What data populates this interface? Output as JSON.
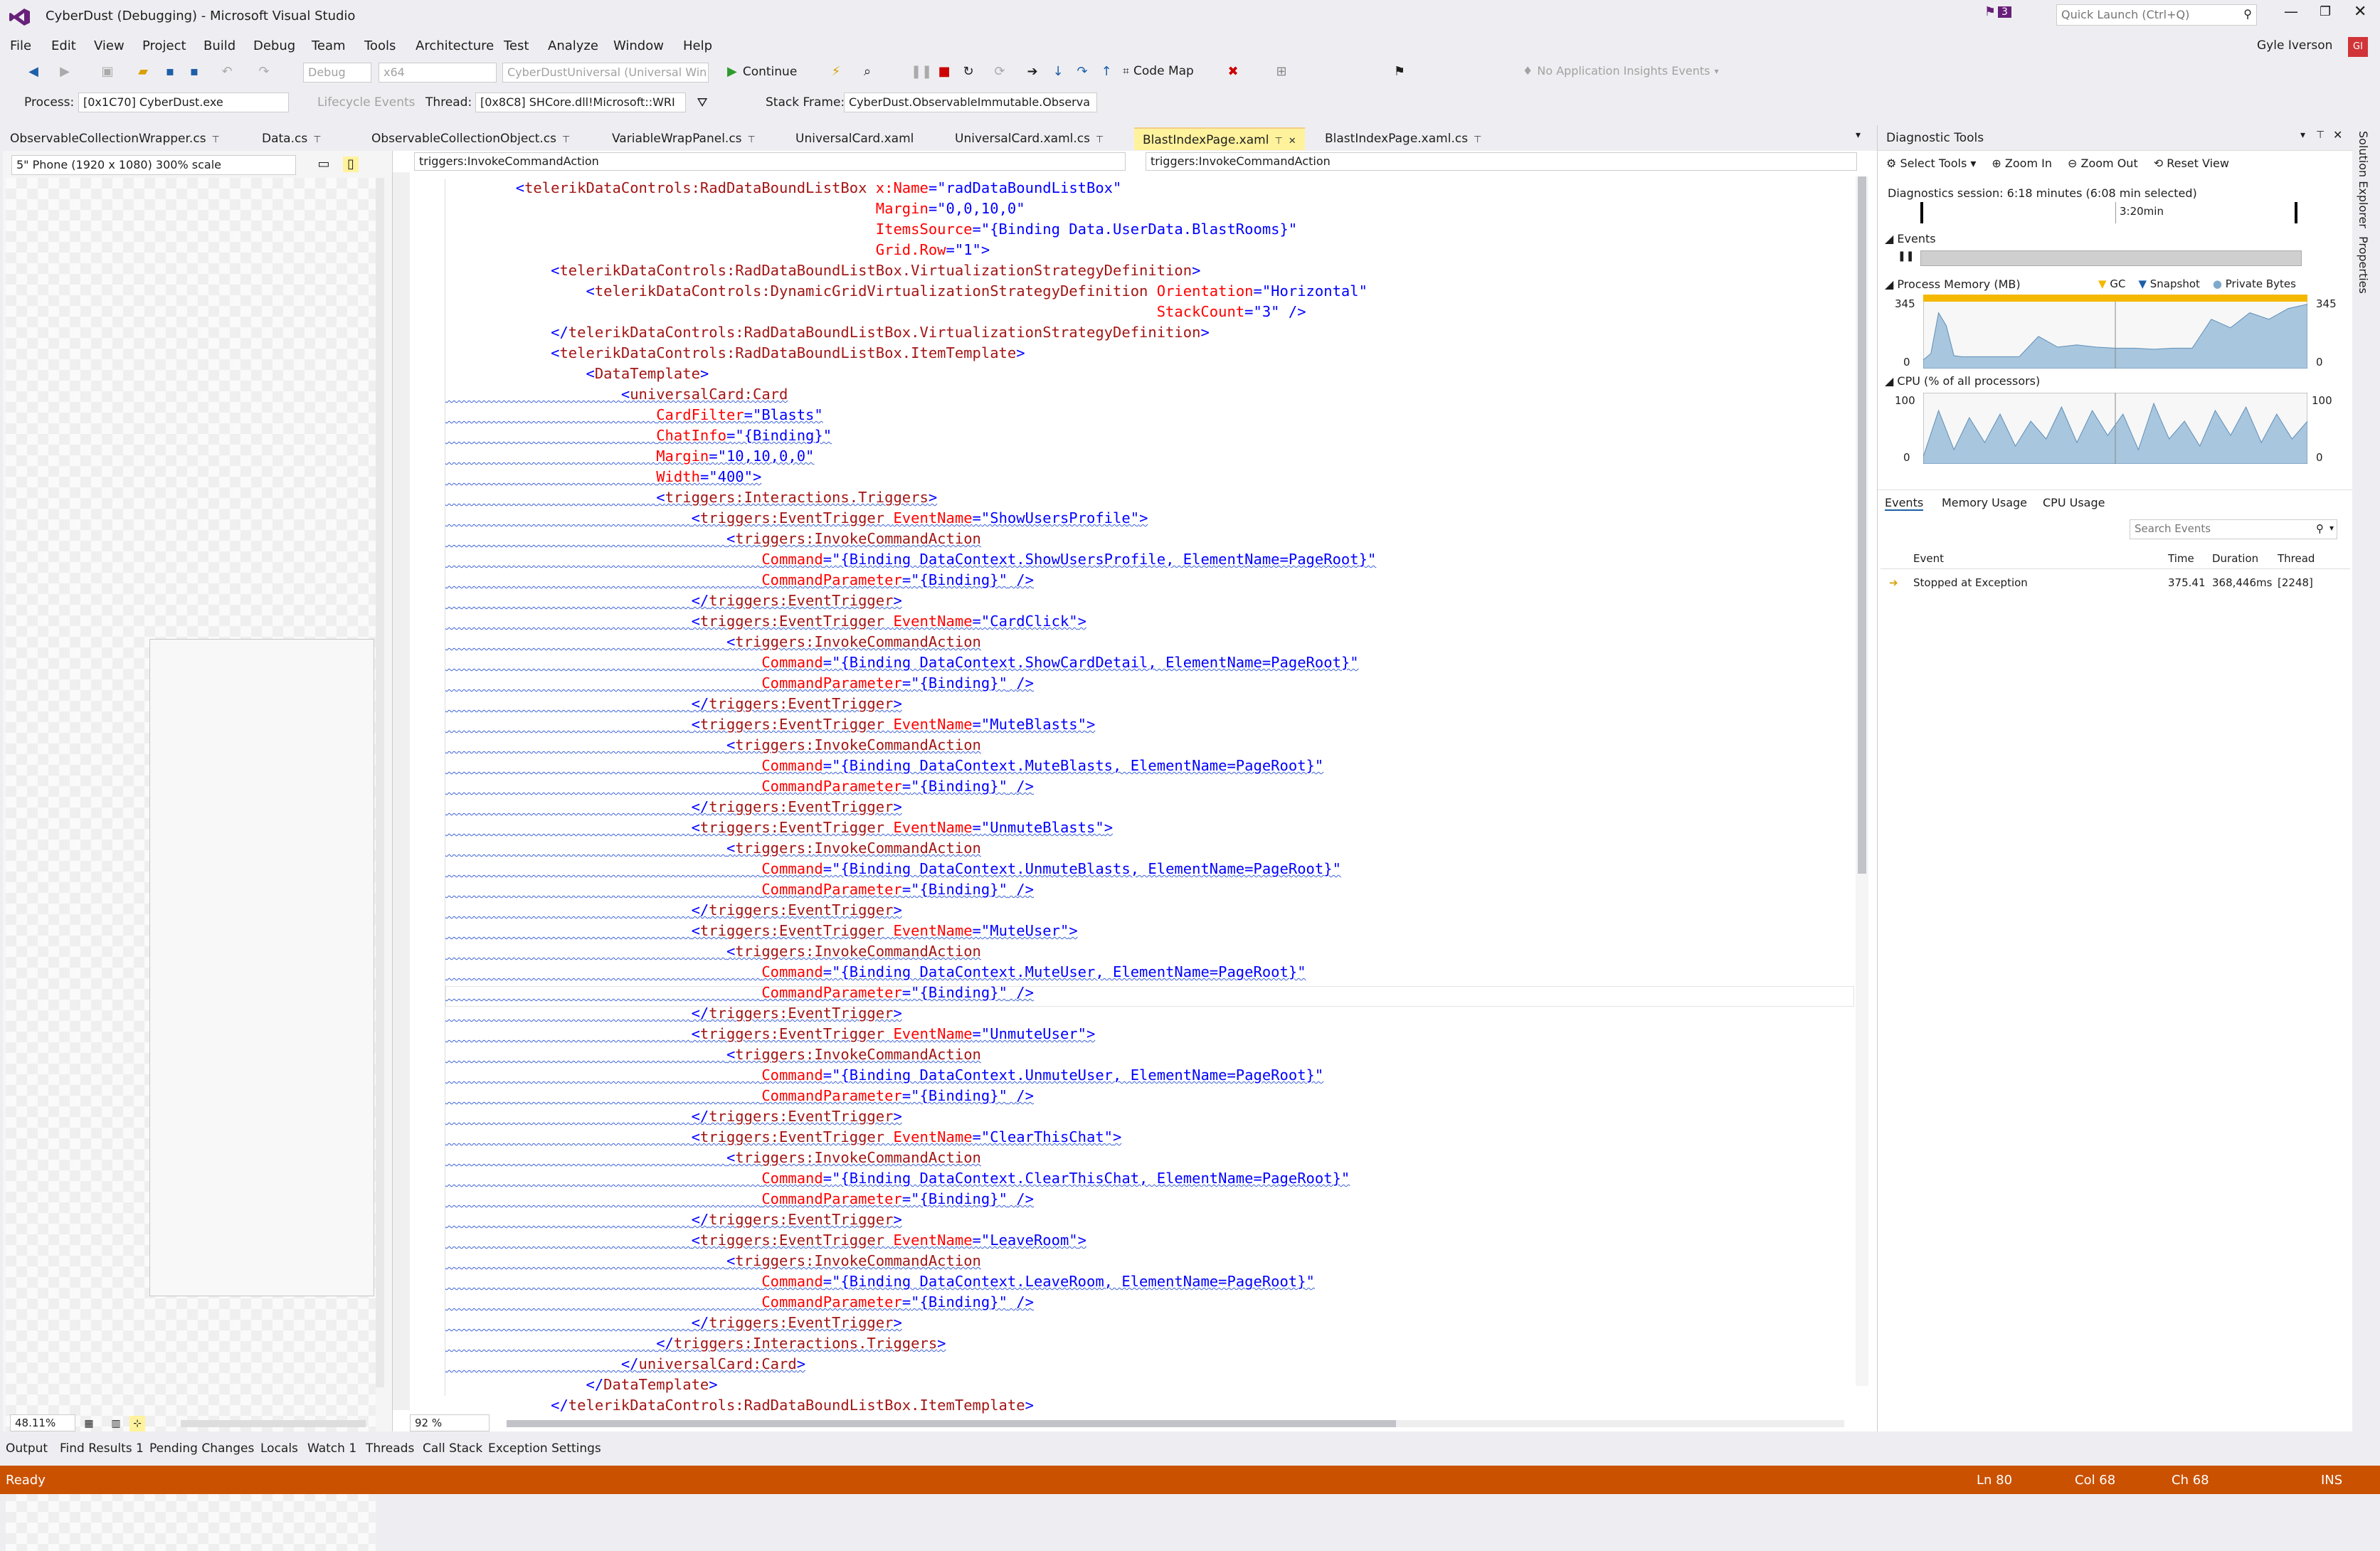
{
  "window": {
    "title": "CyberDust (Debugging) - Microsoft Visual Studio",
    "notifications": "3",
    "quick_launch_placeholder": "Quick Launch (Ctrl+Q)",
    "user": "Gyle Iverson"
  },
  "menu": [
    "File",
    "Edit",
    "View",
    "Project",
    "Build",
    "Debug",
    "Team",
    "Tools",
    "Architecture",
    "Test",
    "Analyze",
    "Window",
    "Help"
  ],
  "toolbar": {
    "config": "Debug",
    "platform": "x64",
    "startup": "CyberDustUniversal (Universal Win",
    "continue": "Continue",
    "codemap": "Code Map",
    "insights": "No Application Insights Events"
  },
  "debugbar": {
    "process_label": "Process:",
    "process": "[0x1C70] CyberDust.exe",
    "lifecycle": "Lifecycle Events",
    "thread_label": "Thread:",
    "thread": "[0x8C8] SHCore.dll!Microsoft::WRI",
    "stackframe_label": "Stack Frame:",
    "stackframe": "CyberDust.ObservableImmutable.Observa"
  },
  "tabs": [
    "ObservableCollectionWrapper.cs",
    "Data.cs",
    "ObservableCollectionObject.cs",
    "VariableWrapPanel.cs",
    "UniversalCard.xaml",
    "UniversalCard.xaml.cs",
    "BlastIndexPage.xaml",
    "BlastIndexPage.xaml.cs"
  ],
  "designer": {
    "device": "5\" Phone (1920 x 1080) 300% scale",
    "zoom": "48.11%"
  },
  "editor": {
    "nav_left": "triggers:InvokeCommandAction",
    "nav_right": "triggers:InvokeCommandAction",
    "zoom": "92 %"
  },
  "code": [
    "        <telerikDataControls:RadDataBoundListBox x:Name=\"radDataBoundListBox\"",
    "                                                 Margin=\"0,0,10,0\"",
    "                                                 ItemsSource=\"{Binding Data.UserData.BlastRooms}\"",
    "                                                 Grid.Row=\"1\">",
    "            <telerikDataControls:RadDataBoundListBox.VirtualizationStrategyDefinition>",
    "                <telerikDataControls:DynamicGridVirtualizationStrategyDefinition Orientation=\"Horizontal\"",
    "                                                                                 StackCount=\"3\" />",
    "            </telerikDataControls:RadDataBoundListBox.VirtualizationStrategyDefinition>",
    "            <telerikDataControls:RadDataBoundListBox.ItemTemplate>",
    "                <DataTemplate>",
    "                    <universalCard:Card",
    "                        CardFilter=\"Blasts\"",
    "                        ChatInfo=\"{Binding}\"",
    "                        Margin=\"10,10,0,0\"",
    "                        Width=\"400\">",
    "                        <triggers:Interactions.Triggers>",
    "                            <triggers:EventTrigger EventName=\"ShowUsersProfile\">",
    "                                <triggers:InvokeCommandAction",
    "                                    Command=\"{Binding DataContext.ShowUsersProfile, ElementName=PageRoot}\"",
    "                                    CommandParameter=\"{Binding}\" />",
    "                            </triggers:EventTrigger>",
    "                            <triggers:EventTrigger EventName=\"CardClick\">",
    "                                <triggers:InvokeCommandAction",
    "                                    Command=\"{Binding DataContext.ShowCardDetail, ElementName=PageRoot}\"",
    "                                    CommandParameter=\"{Binding}\" />",
    "                            </triggers:EventTrigger>",
    "                            <triggers:EventTrigger EventName=\"MuteBlasts\">",
    "                                <triggers:InvokeCommandAction",
    "                                    Command=\"{Binding DataContext.MuteBlasts, ElementName=PageRoot}\"",
    "                                    CommandParameter=\"{Binding}\" />",
    "                            </triggers:EventTrigger>",
    "                            <triggers:EventTrigger EventName=\"UnmuteBlasts\">",
    "                                <triggers:InvokeCommandAction",
    "                                    Command=\"{Binding DataContext.UnmuteBlasts, ElementName=PageRoot}\"",
    "                                    CommandParameter=\"{Binding}\" />",
    "                            </triggers:EventTrigger>",
    "                            <triggers:EventTrigger EventName=\"MuteUser\">",
    "                                <triggers:InvokeCommandAction",
    "                                    Command=\"{Binding DataContext.MuteUser, ElementName=PageRoot}\"",
    "                                    CommandParameter=\"{Binding}\" />",
    "                            </triggers:EventTrigger>",
    "                            <triggers:EventTrigger EventName=\"UnmuteUser\">",
    "                                <triggers:InvokeCommandAction",
    "                                    Command=\"{Binding DataContext.UnmuteUser, ElementName=PageRoot}\"",
    "                                    CommandParameter=\"{Binding}\" />",
    "                            </triggers:EventTrigger>",
    "                            <triggers:EventTrigger EventName=\"ClearThisChat\">",
    "                                <triggers:InvokeCommandAction",
    "                                    Command=\"{Binding DataContext.ClearThisChat, ElementName=PageRoot}\"",
    "                                    CommandParameter=\"{Binding}\" />",
    "                            </triggers:EventTrigger>",
    "                            <triggers:EventTrigger EventName=\"LeaveRoom\">",
    "                                <triggers:InvokeCommandAction",
    "                                    Command=\"{Binding DataContext.LeaveRoom, ElementName=PageRoot}\"",
    "                                    CommandParameter=\"{Binding}\" />",
    "                            </triggers:EventTrigger>",
    "                        </triggers:Interactions.Triggers>",
    "                    </universalCard:Card>",
    "                </DataTemplate>",
    "            </telerikDataControls:RadDataBoundListBox.ItemTemplate>"
  ],
  "diagnostics": {
    "title": "Diagnostic Tools",
    "toolbar": [
      "Select Tools",
      "Zoom In",
      "Zoom Out",
      "Reset View"
    ],
    "session": "Diagnostics session: 6:18 minutes (6:08 min selected)",
    "timeline_marker": "3:20min",
    "events_label": "Events",
    "memory_label": "Process Memory (MB)",
    "memory_legend": [
      "GC",
      "Snapshot",
      "Private Bytes"
    ],
    "memory_max": "345",
    "memory_min": "0",
    "cpu_label": "CPU (% of all processors)",
    "cpu_max": "100",
    "cpu_min": "0",
    "tabs": [
      "Events",
      "Memory Usage",
      "CPU Usage"
    ],
    "search_placeholder": "Search Events",
    "columns": [
      "Event",
      "Time",
      "Duration",
      "Thread"
    ],
    "rows": [
      {
        "event": "Stopped at Exception",
        "time": "375.41",
        "duration": "368,446ms",
        "thread": "[2248]"
      }
    ]
  },
  "rightrail": [
    "Solution Explorer",
    "Properties"
  ],
  "bottom_tabs": [
    "Output",
    "Find Results 1",
    "Pending Changes",
    "Locals",
    "Watch 1",
    "Threads",
    "Call Stack",
    "Exception Settings"
  ],
  "status": {
    "text": "Ready",
    "ln": "Ln 80",
    "col": "Col 68",
    "ch": "Ch 68",
    "mode": "INS"
  },
  "colors": {
    "statusbar": "#ca5100",
    "accent": "#68217a",
    "active_tab": "#fff29d",
    "xml_tag": "#a31515",
    "xml_attr": "#ff0000",
    "xml_value": "#0000ff",
    "chart_fill": "#a8c6de",
    "gc_color": "#f5b800"
  },
  "chart_data": [
    {
      "type": "area",
      "title": "Process Memory (MB)",
      "ylim": [
        0,
        345
      ],
      "x": [
        0,
        2,
        4,
        6,
        8,
        10,
        15,
        20,
        25,
        30,
        35,
        40,
        45,
        50,
        55,
        60,
        65,
        70,
        75,
        80,
        85,
        90,
        95,
        100
      ],
      "series": [
        {
          "name": "Private Bytes",
          "values": [
            40,
            70,
            260,
            200,
            60,
            55,
            55,
            55,
            55,
            150,
            100,
            110,
            100,
            95,
            95,
            90,
            95,
            95,
            230,
            190,
            260,
            230,
            280,
            300
          ]
        }
      ]
    },
    {
      "type": "area",
      "title": "CPU (% of all processors)",
      "ylim": [
        0,
        100
      ],
      "x": [
        0,
        4,
        8,
        12,
        16,
        20,
        24,
        28,
        32,
        36,
        40,
        44,
        48,
        52,
        56,
        60,
        64,
        68,
        72,
        76,
        80,
        84,
        88,
        92,
        96,
        100
      ],
      "series": [
        {
          "name": "CPU",
          "values": [
            10,
            75,
            20,
            65,
            30,
            70,
            25,
            60,
            35,
            80,
            30,
            75,
            40,
            70,
            20,
            85,
            35,
            60,
            25,
            75,
            40,
            80,
            30,
            70,
            35,
            60
          ]
        }
      ]
    }
  ]
}
